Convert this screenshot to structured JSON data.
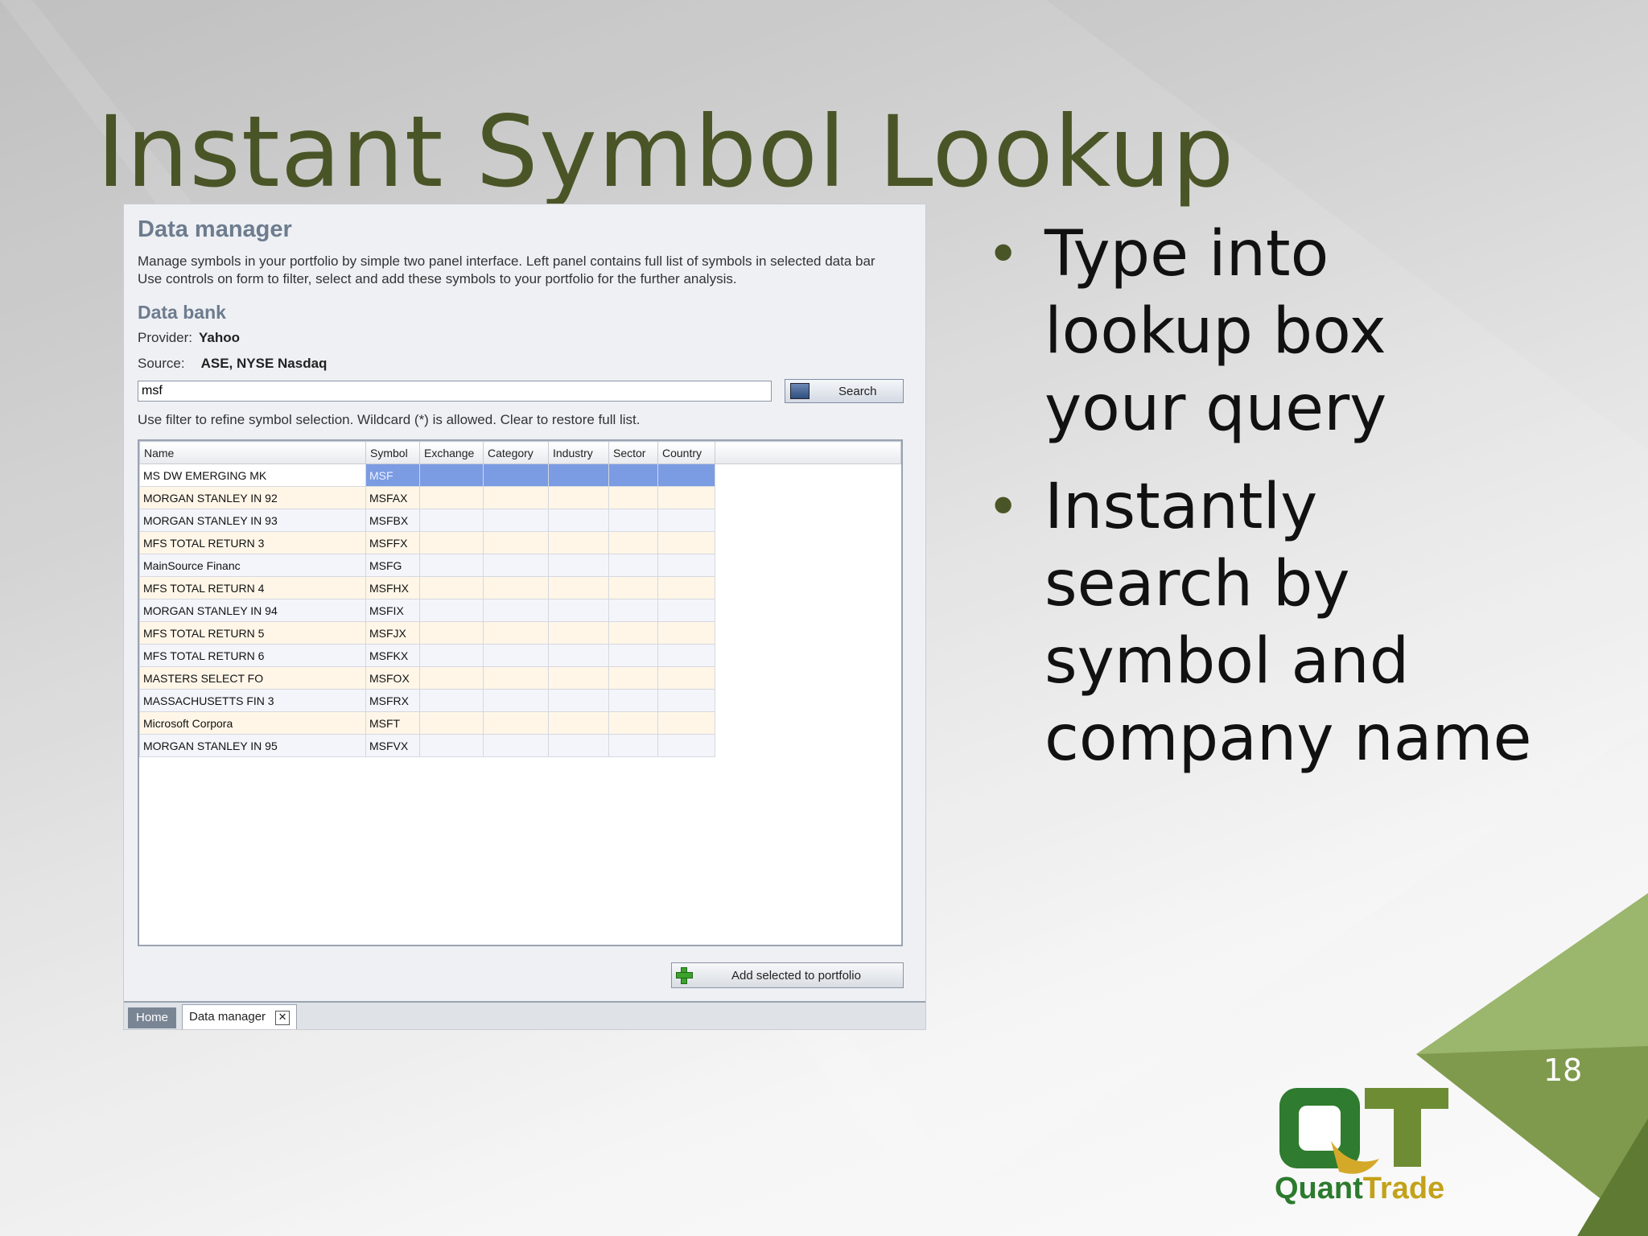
{
  "slide": {
    "title": "Instant Symbol Lookup",
    "bullets": [
      "Type into lookup box your query",
      "Instantly search by symbol and company name"
    ],
    "page_number": "18"
  },
  "app": {
    "heading": "Data manager",
    "description_line1": "Manage symbols in your portfolio by simple two panel interface. Left panel contains full list of symbols in selected data bar",
    "description_line2": "Use controls on form to filter, select and add these symbols to your portfolio for the further analysis.",
    "data_bank_heading": "Data bank",
    "provider_label": "Provider:",
    "provider_value": "Yahoo",
    "source_label": "Source:",
    "source_value": "ASE, NYSE  Nasdaq",
    "search": {
      "value": "msf",
      "button_label": "Search"
    },
    "filter_hint": "Use filter to refine symbol selection. Wildcard (*) is allowed. Clear to restore full list.",
    "columns": [
      "Name",
      "Symbol",
      "Exchange",
      "Category",
      "Industry",
      "Sector",
      "Country"
    ],
    "rows": [
      {
        "name": "MS DW EMERGING MK",
        "symbol": "MSF"
      },
      {
        "name": "MORGAN STANLEY IN 92",
        "symbol": "MSFAX"
      },
      {
        "name": "MORGAN STANLEY IN 93",
        "symbol": "MSFBX"
      },
      {
        "name": "MFS TOTAL RETURN 3",
        "symbol": "MSFFX"
      },
      {
        "name": "MainSource Financ",
        "symbol": "MSFG"
      },
      {
        "name": "MFS TOTAL RETURN 4",
        "symbol": "MSFHX"
      },
      {
        "name": "MORGAN STANLEY IN 94",
        "symbol": "MSFIX"
      },
      {
        "name": "MFS TOTAL RETURN 5",
        "symbol": "MSFJX"
      },
      {
        "name": "MFS TOTAL RETURN 6",
        "symbol": "MSFKX"
      },
      {
        "name": "MASTERS SELECT FO",
        "symbol": "MSFOX"
      },
      {
        "name": "MASSACHUSETTS FIN 3",
        "symbol": "MSFRX"
      },
      {
        "name": "Microsoft Corpora",
        "symbol": "MSFT"
      },
      {
        "name": "MORGAN STANLEY IN 95",
        "symbol": "MSFVX"
      }
    ],
    "add_button_label": "Add selected to portfolio",
    "tabs": {
      "home": "Home",
      "data_manager": "Data manager",
      "close": "✕"
    }
  },
  "logo": {
    "text_part1": "Quant",
    "text_part2": "Trade"
  },
  "colors": {
    "title": "#4a5527",
    "accent_green": "#6f8a3c",
    "selection": "#7b9be3"
  }
}
